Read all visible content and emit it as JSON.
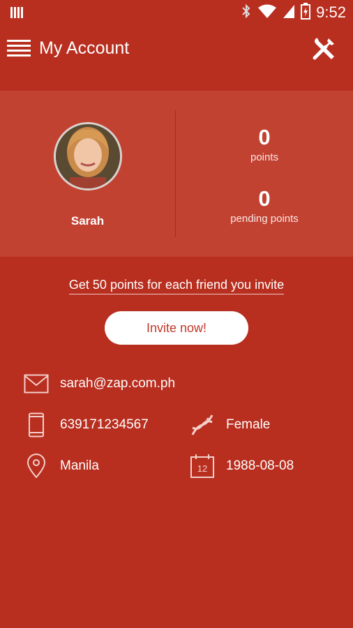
{
  "statusbar": {
    "time": "9:52",
    "icons": [
      "notification-icon",
      "bluetooth-icon",
      "wifi-icon",
      "signal-icon",
      "battery-charging-icon"
    ]
  },
  "appbar": {
    "title": "My Account",
    "menu_icon": "hamburger-menu-icon",
    "settings_icon": "tools-icon"
  },
  "profile": {
    "name": "Sarah",
    "points_value": "0",
    "points_label": "points",
    "pending_value": "0",
    "pending_label": "pending points"
  },
  "invite": {
    "link_text": "Get 50 points for each friend you invite",
    "button_label": "Invite now!"
  },
  "details": {
    "email": "sarah@zap.com.ph",
    "phone": "639171234567",
    "gender": "Female",
    "location": "Manila",
    "birthday": "1988-08-08",
    "calendar_day": "12"
  },
  "colors": {
    "background": "#b82e1f",
    "panel": "#c24232",
    "accent_text": "#c0392b"
  }
}
